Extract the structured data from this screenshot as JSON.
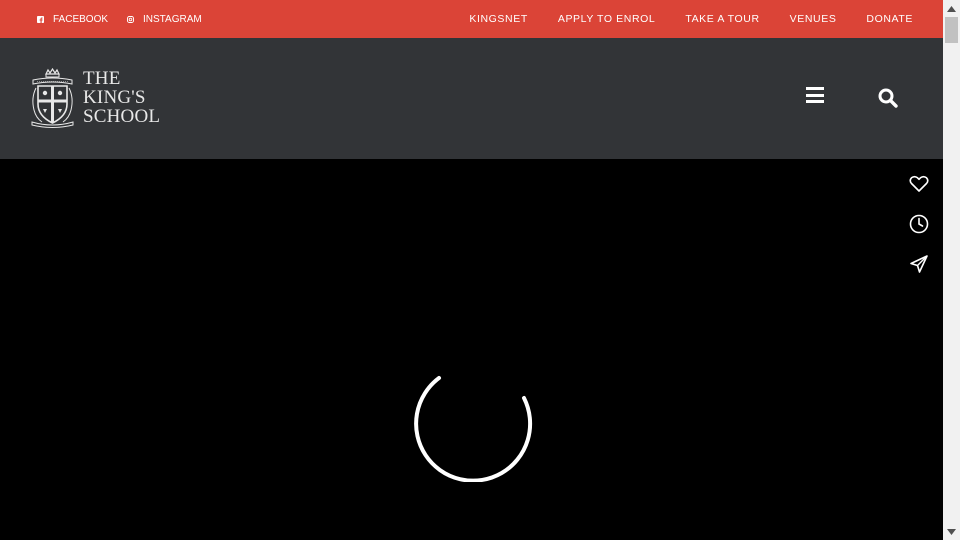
{
  "topbar": {
    "social": [
      {
        "label": "FACEBOOK",
        "icon": "facebook-icon"
      },
      {
        "label": "INSTAGRAM",
        "icon": "instagram-icon"
      }
    ],
    "links": [
      "KINGSNET",
      "APPLY TO ENROL",
      "TAKE A TOUR",
      "VENUES",
      "DONATE"
    ]
  },
  "header": {
    "logo_lines": [
      "THE",
      "KING'S",
      "SCHOOL"
    ],
    "menu_icon": "hamburger-menu-icon",
    "search_icon": "search-icon"
  },
  "hero": {
    "tools": [
      "heart-icon",
      "clock-icon",
      "send-icon"
    ],
    "loading": "loading-spinner"
  },
  "colors": {
    "topbar_bg": "#db4437",
    "header_bg": "#323437",
    "hero_bg": "#000000"
  }
}
